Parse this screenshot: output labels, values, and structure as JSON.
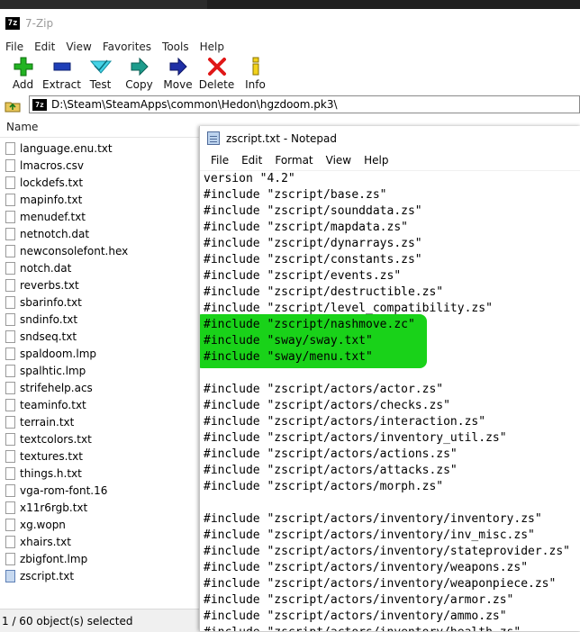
{
  "zip": {
    "title": "7-Zip",
    "menu": [
      "File",
      "Edit",
      "View",
      "Favorites",
      "Tools",
      "Help"
    ],
    "toolbar": [
      {
        "label": "Add",
        "icon": "add-icon"
      },
      {
        "label": "Extract",
        "icon": "extract-icon"
      },
      {
        "label": "Test",
        "icon": "test-icon"
      },
      {
        "label": "Copy",
        "icon": "copy-icon"
      },
      {
        "label": "Move",
        "icon": "move-icon"
      },
      {
        "label": "Delete",
        "icon": "delete-icon"
      },
      {
        "label": "Info",
        "icon": "info-icon"
      }
    ],
    "address": "D:\\Steam\\SteamApps\\common\\Hedon\\hgzdoom.pk3\\",
    "column_name": "Name",
    "files": [
      "language.enu.txt",
      "lmacros.csv",
      "lockdefs.txt",
      "mapinfo.txt",
      "menudef.txt",
      "netnotch.dat",
      "newconsolefont.hex",
      "notch.dat",
      "reverbs.txt",
      "sbarinfo.txt",
      "sndinfo.txt",
      "sndseq.txt",
      "spaldoom.lmp",
      "spalhtic.lmp",
      "strifehelp.acs",
      "teaminfo.txt",
      "terrain.txt",
      "textcolors.txt",
      "textures.txt",
      "things.h.txt",
      "vga-rom-font.16",
      "x11r6rgb.txt",
      "xg.wopn",
      "xhairs.txt",
      "zbigfont.lmp",
      "zscript.txt"
    ],
    "selected_file": "zscript.txt",
    "status": "1 / 60 object(s) selected"
  },
  "notepad": {
    "title": "zscript.txt - Notepad",
    "menu": [
      "File",
      "Edit",
      "Format",
      "View",
      "Help"
    ],
    "lines": [
      "version \"4.2\"",
      "#include \"zscript/base.zs\"",
      "#include \"zscript/sounddata.zs\"",
      "#include \"zscript/mapdata.zs\"",
      "#include \"zscript/dynarrays.zs\"",
      "#include \"zscript/constants.zs\"",
      "#include \"zscript/events.zs\"",
      "#include \"zscript/destructible.zs\"",
      "#include \"zscript/level_compatibility.zs\"",
      "#include \"zscript/nashmove.zc\"",
      "#include \"sway/sway.txt\"",
      "#include \"sway/menu.txt\"",
      "",
      "#include \"zscript/actors/actor.zs\"",
      "#include \"zscript/actors/checks.zs\"",
      "#include \"zscript/actors/interaction.zs\"",
      "#include \"zscript/actors/inventory_util.zs\"",
      "#include \"zscript/actors/actions.zs\"",
      "#include \"zscript/actors/attacks.zs\"",
      "#include \"zscript/actors/morph.zs\"",
      "",
      "#include \"zscript/actors/inventory/inventory.zs\"",
      "#include \"zscript/actors/inventory/inv_misc.zs\"",
      "#include \"zscript/actors/inventory/stateprovider.zs\"",
      "#include \"zscript/actors/inventory/weapons.zs\"",
      "#include \"zscript/actors/inventory/weaponpiece.zs\"",
      "#include \"zscript/actors/inventory/armor.zs\"",
      "#include \"zscript/actors/inventory/ammo.zs\"",
      "#include \"zscript/actors/inventory/health.zs\""
    ],
    "highlighted_lines": [
      9,
      10,
      11
    ],
    "highlight_color": "#19d219"
  }
}
